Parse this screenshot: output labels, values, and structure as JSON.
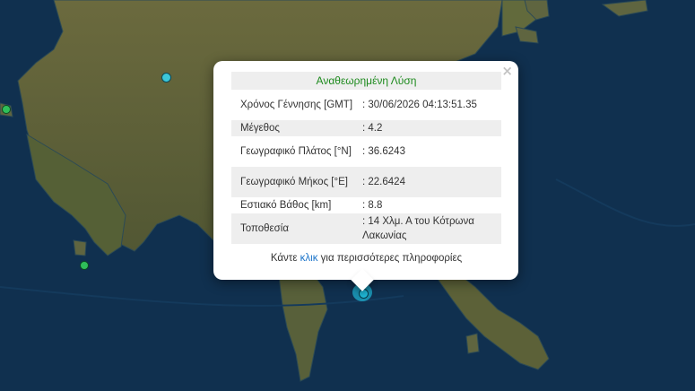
{
  "popup": {
    "title": "Αναθεωρημένη Λύση",
    "close_label": "×",
    "rows": [
      {
        "key": "Χρόνος Γέννησης [GMT]",
        "value": ": 30/06/2026 04:13:51.35"
      },
      {
        "key": "Μέγεθος",
        "value": ": 4.2"
      },
      {
        "key": "Γεωγραφικό Πλάτος [°N]",
        "value": ": 36.6243"
      },
      {
        "key": "Γεωγραφικό Μήκος [°E]",
        "value": ": 22.6424"
      },
      {
        "key": "Εστιακό Βάθος [km]",
        "value": ": 8.8"
      },
      {
        "key": "Τοποθεσία",
        "value": ": 14 Χλμ. Α του Κότρωνα Λακωνίας"
      }
    ],
    "more_prefix": "Κάντε ",
    "more_link": "κλικ",
    "more_suffix": " για περισσότερες πληροφορίες"
  },
  "colors": {
    "sea": "#0f2a45",
    "land": "#5a5a36",
    "marker_active": "#1fb7d6",
    "marker_cyan": "#3cc7d9",
    "marker_green": "#2fbf5a",
    "title_green": "#1d8a1d",
    "link_blue": "#1a73c9"
  },
  "markers": [
    {
      "name": "selected-event",
      "color": "cyan",
      "size": "large"
    },
    {
      "name": "event-north",
      "color": "cyan",
      "size": "small"
    },
    {
      "name": "event-west",
      "color": "green",
      "size": "small"
    },
    {
      "name": "event-south-west",
      "color": "green",
      "size": "small"
    }
  ]
}
